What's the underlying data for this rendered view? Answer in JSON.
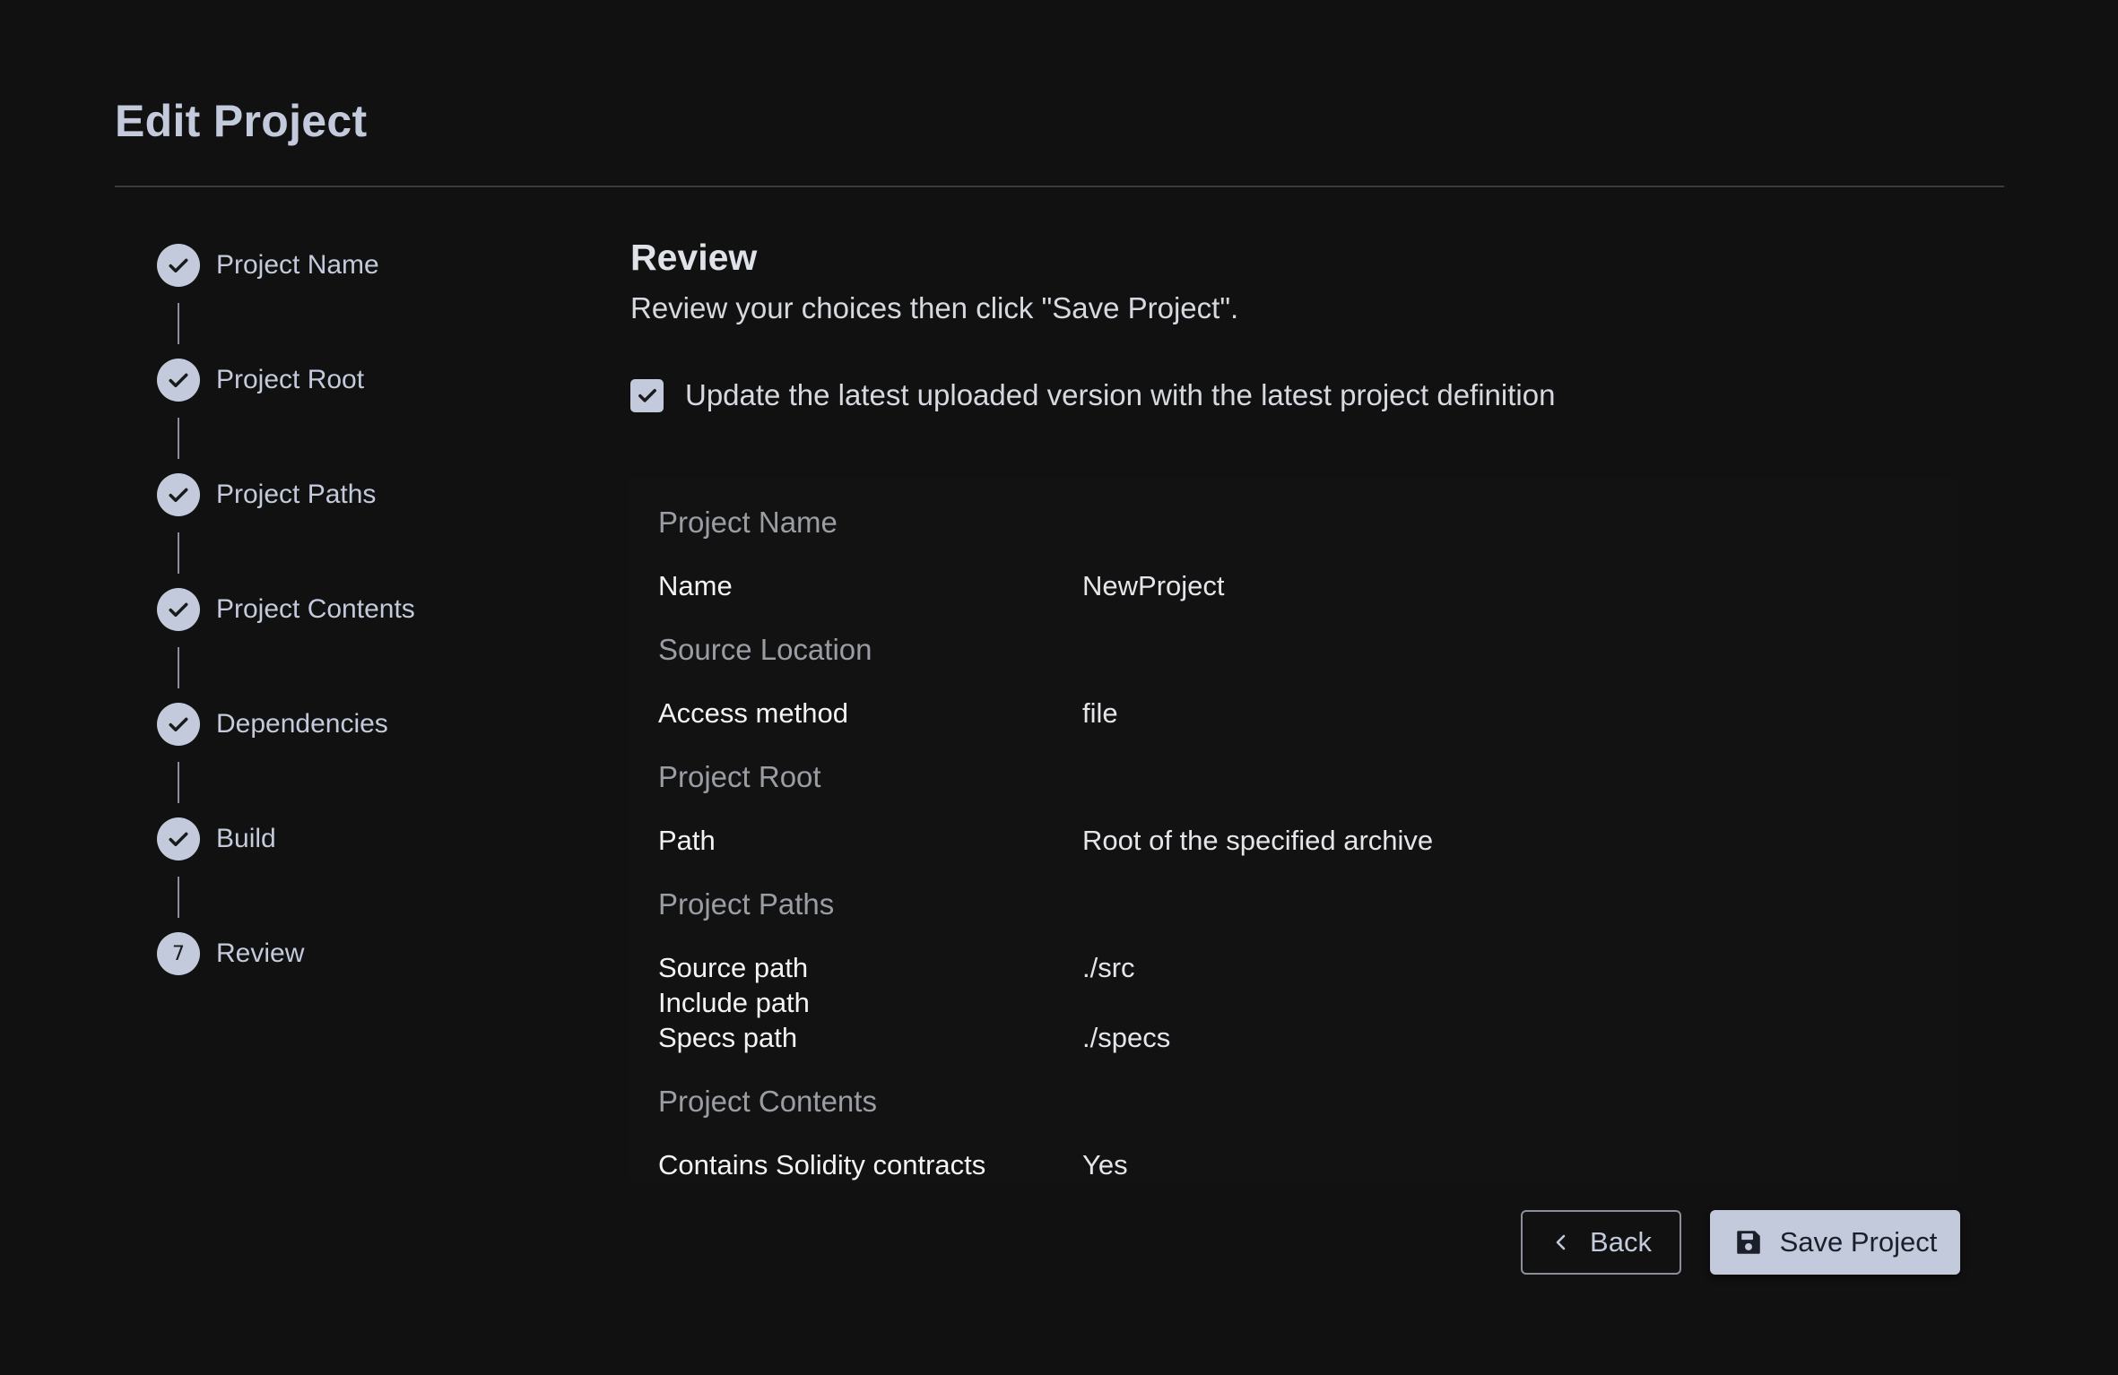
{
  "header": {
    "title": "Edit Project"
  },
  "stepper": {
    "steps": [
      {
        "label": "Project Name",
        "state": "complete",
        "icon": "check-icon"
      },
      {
        "label": "Project Root",
        "state": "complete",
        "icon": "check-icon"
      },
      {
        "label": "Project Paths",
        "state": "complete",
        "icon": "check-icon"
      },
      {
        "label": "Project Contents",
        "state": "complete",
        "icon": "check-icon"
      },
      {
        "label": "Dependencies",
        "state": "complete",
        "icon": "check-icon"
      },
      {
        "label": "Build",
        "state": "complete",
        "icon": "check-icon"
      },
      {
        "label": "Review",
        "state": "current",
        "number": "7"
      }
    ]
  },
  "main": {
    "title": "Review",
    "subtitle": "Review your choices then click \"Save Project\".",
    "update_checkbox": {
      "label": "Update the latest uploaded version with the latest project definition",
      "checked": true
    },
    "review": {
      "project_name_group": "Project Name",
      "name_key": "Name",
      "name_value": "NewProject",
      "source_location_group": "Source Location",
      "access_method_key": "Access method",
      "access_method_value": "file",
      "project_root_group": "Project Root",
      "path_key": "Path",
      "path_value": "Root of the specified archive",
      "project_paths_group": "Project Paths",
      "source_path_key": "Source path",
      "source_path_value": "./src",
      "include_path_key": "Include path",
      "include_path_value": "",
      "specs_path_key": "Specs path",
      "specs_path_value": "./specs",
      "project_contents_group": "Project Contents",
      "solidity_key": "Contains Solidity contracts",
      "solidity_value": "Yes"
    }
  },
  "actions": {
    "back_label": "Back",
    "save_label": "Save Project"
  },
  "colors": {
    "background": "#111111",
    "accent": "#c2cadb",
    "muted": "#9a9da3"
  }
}
